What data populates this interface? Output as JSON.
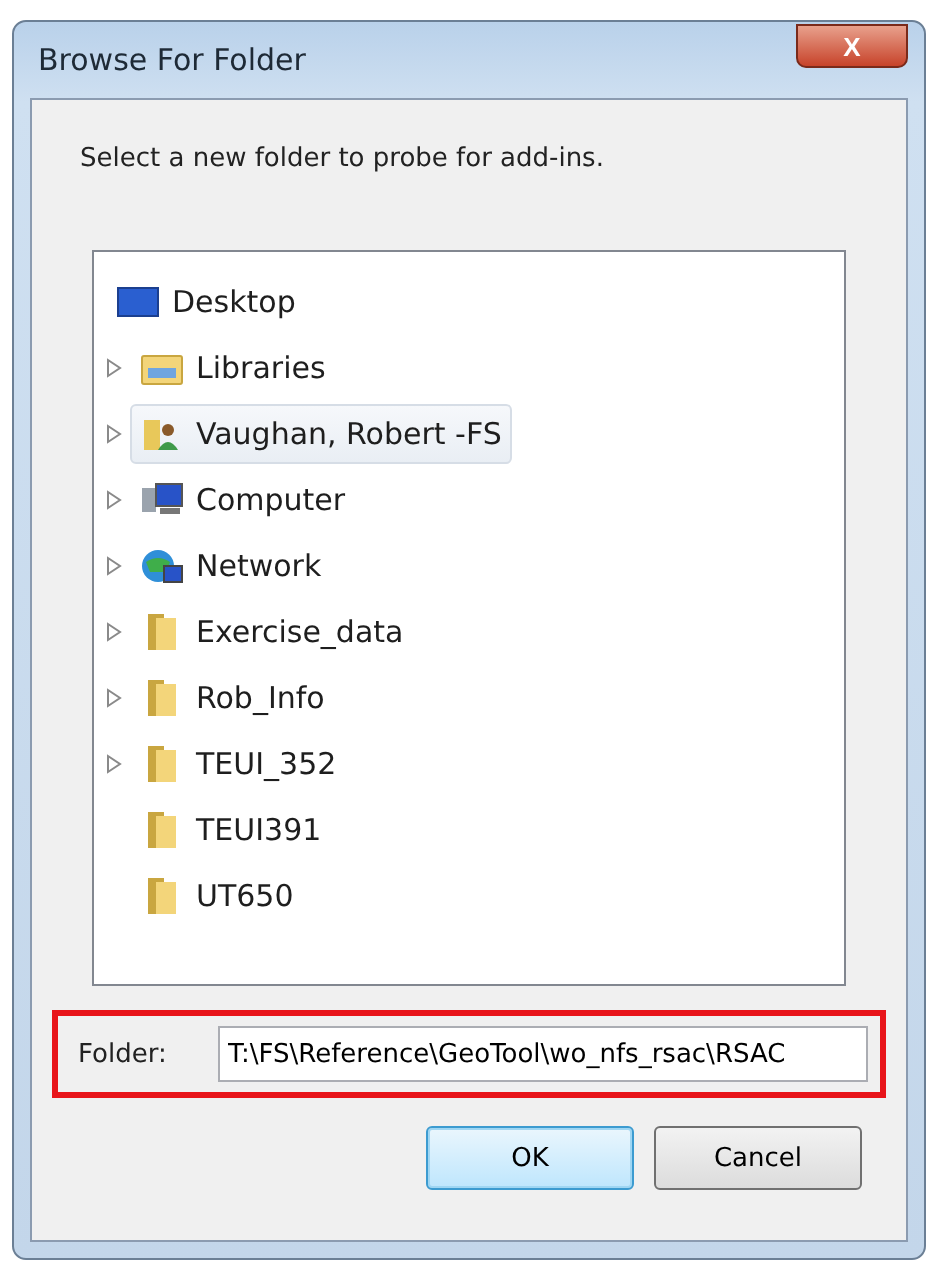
{
  "window": {
    "title": "Browse For Folder",
    "close_label": "X"
  },
  "instruction": "Select a new folder to probe for add-ins.",
  "tree": [
    {
      "label": "Desktop",
      "kind": "desktop",
      "selected": false,
      "children": [
        {
          "label": "Libraries",
          "kind": "library",
          "selected": false,
          "expandable": true
        },
        {
          "label": "Vaughan, Robert -FS",
          "kind": "user",
          "selected": true,
          "expandable": true
        },
        {
          "label": "Computer",
          "kind": "computer",
          "selected": false,
          "expandable": true
        },
        {
          "label": "Network",
          "kind": "network",
          "selected": false,
          "expandable": true
        },
        {
          "label": "Exercise_data",
          "kind": "folder",
          "selected": false,
          "expandable": true
        },
        {
          "label": "Rob_Info",
          "kind": "folder",
          "selected": false,
          "expandable": true
        },
        {
          "label": "TEUI_352",
          "kind": "folder",
          "selected": false,
          "expandable": true
        },
        {
          "label": "TEUI391",
          "kind": "folder",
          "selected": false,
          "expandable": false
        },
        {
          "label": "UT650",
          "kind": "folder",
          "selected": false,
          "expandable": false
        }
      ]
    }
  ],
  "folder_field": {
    "label": "Folder:",
    "value": "T:\\FS\\Reference\\GeoTool\\wo_nfs_rsac\\RSAC",
    "highlighted": true
  },
  "buttons": [
    {
      "label": "OK",
      "kind": "default"
    },
    {
      "label": "Cancel",
      "kind": "normal"
    }
  ]
}
